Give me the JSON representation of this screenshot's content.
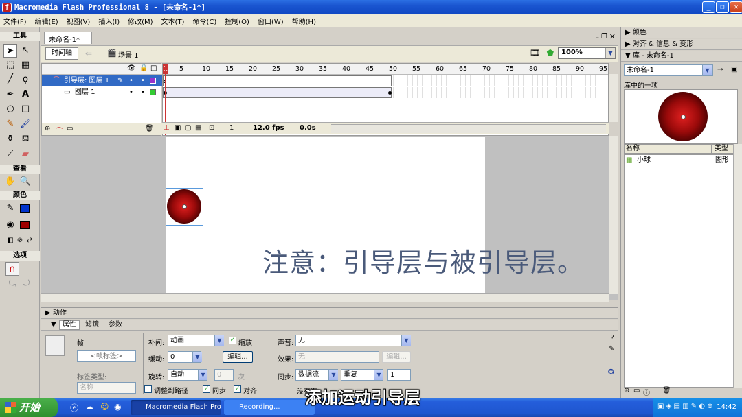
{
  "window": {
    "title": "Macromedia Flash Professional 8 - [未命名-1*]",
    "controls": [
      "_",
      "❐",
      "✕"
    ]
  },
  "menu": [
    "文件(F)",
    "编辑(E)",
    "视图(V)",
    "插入(I)",
    "修改(M)",
    "文本(T)",
    "命令(C)",
    "控制(O)",
    "窗口(W)",
    "帮助(H)"
  ],
  "toolbox": {
    "tools_label": "工具",
    "view_label": "查看",
    "colors_label": "颜色",
    "options_label": "选项"
  },
  "document": {
    "tab": "未命名-1*",
    "timeline_button": "时间轴",
    "scene": "场景 1",
    "zoom": "100%"
  },
  "timeline": {
    "ruler": [
      "1",
      "5",
      "10",
      "15",
      "20",
      "25",
      "30",
      "35",
      "40",
      "45",
      "50",
      "55",
      "60",
      "65",
      "70",
      "75",
      "80",
      "85",
      "90",
      "95"
    ],
    "layers": [
      {
        "name": "引导层: 图层 1",
        "selected": true,
        "color": "#9933cc"
      },
      {
        "name": "图层 1",
        "selected": false,
        "color": "#33cc33"
      }
    ],
    "current_frame": "1",
    "fps": "12.0 fps",
    "time": "0.0s"
  },
  "stage": {
    "note_text": "注意：引导层与被引导层。"
  },
  "properties": {
    "actions_label": "动作",
    "tabs": [
      "属性",
      "滤镜",
      "参数"
    ],
    "frame_label": "帧",
    "frame_name_placeholder": "<帧标签>",
    "label_type_label": "标签类型:",
    "label_type_value": "名称",
    "tween_label": "补间:",
    "tween_value": "动画",
    "scale_label": "缩放",
    "ease_label": "缓动:",
    "ease_value": "0",
    "edit_button": "编辑...",
    "rotate_label": "旋转:",
    "rotate_value": "自动",
    "rotate_count": "0",
    "rotate_unit": "次",
    "orient_label": "调整到路径",
    "sync_label": "同步",
    "snap_label": "对齐",
    "sound_label": "声音:",
    "sound_value": "无",
    "effect_label": "效果:",
    "effect_value": "无",
    "effect_edit": "编辑...",
    "sync_label2": "同步:",
    "sync_value": "数据流",
    "repeat_value": "重复",
    "repeat_count": "1",
    "no_sound": "没有选"
  },
  "right_panel": {
    "color_panel": "颜色",
    "align_panel": "对齐 & 信息 & 变形",
    "library_panel": "库 - 未命名-1",
    "library_doc": "未命名-1",
    "items_count": "库中的一项",
    "col_name": "名称",
    "col_type": "类型",
    "items": [
      {
        "name": "小球",
        "type": "图形"
      }
    ]
  },
  "taskbar": {
    "start": "开始",
    "tasks": [
      "Macromedia Flash Pro...",
      "Recording..."
    ],
    "clock": "14:42"
  },
  "subtitle": "添加运动引导层"
}
